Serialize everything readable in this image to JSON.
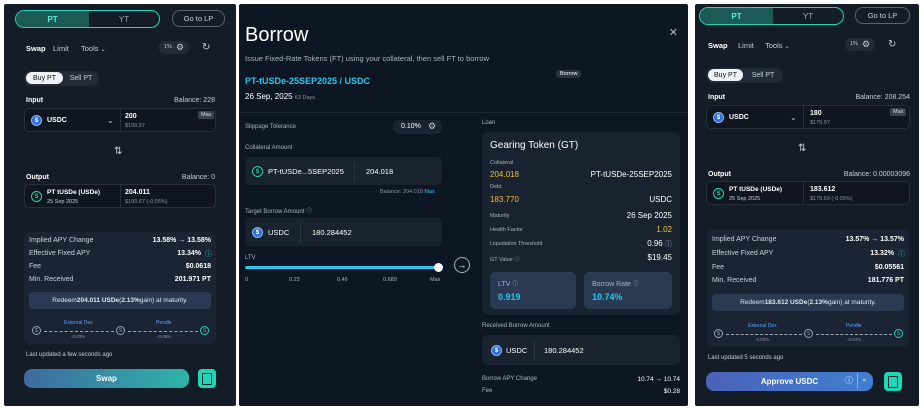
{
  "left": {
    "toggle": {
      "pt": "PT",
      "yt": "YT"
    },
    "go_lp": "Go to LP",
    "tabs": {
      "swap": "Swap",
      "limit": "Limit",
      "tools": "Tools"
    },
    "slippage": "1%",
    "seg": {
      "buy": "Buy PT",
      "sell": "Sell PT"
    },
    "input": {
      "label": "Input",
      "balance": "Balance: 228",
      "token": "USDC",
      "amount": "200",
      "usd": "$199.97",
      "max": "Max"
    },
    "output": {
      "label": "Output",
      "balance": "Balance: 0",
      "token": "PT tUSDe (USDe)",
      "date": "25 Sep 2025",
      "amount": "204.011",
      "usd": "$199.67 (-0.05%)"
    },
    "stats": [
      {
        "label": "Implied APY Change",
        "value": "13.58% → 13.58%"
      },
      {
        "label": "Effective Fixed APY",
        "value": "13.34%"
      },
      {
        "label": "Fee",
        "value": "$0.0618"
      },
      {
        "label": "Min. Received",
        "value": "201.971 PT"
      }
    ],
    "redeem": {
      "pre": "Redeem ",
      "amt": "204.011 USDe",
      "mid": " (",
      "gain": "2.13%",
      "post": " gain) at maturity."
    },
    "route": {
      "a": "External Dex",
      "a_pct": "-0.03%",
      "b": "Pendle",
      "b_pct": "-0.06%"
    },
    "updated": "Last updated a few seconds ago",
    "action": "Swap"
  },
  "middle": {
    "title": "Borrow",
    "subtitle": "Issue Fixed-Rate Tokens (FT) using your collateral, then sell FT to borrow",
    "pair": "PT-tUSDe-25SEP2025 / USDC",
    "tooltip": "Borrow",
    "date": "26 Sep, 2025",
    "days": "63 Days",
    "slippage_label": "Slippage Tolerance",
    "slippage_value": "0.10%",
    "collateral_label": "Collateral Amount",
    "collateral_token": "PT-tUSDe...5SEP2025",
    "collateral_amount": "204.018",
    "collateral_balance": "Balance: 204.018",
    "max": "Max",
    "target_label": "Target Borrow Amount",
    "target_token": "USDC",
    "target_amount": "180.284452",
    "ltv_label": "LTV",
    "ltv_ticks": [
      "0",
      "0.23",
      "0.46",
      "0.689",
      "Max"
    ],
    "ltv_fill": 1.0,
    "loan_label": "Loan",
    "gt_title": "Gearing Token (GT)",
    "gt_rows": [
      {
        "label": "Collateral",
        "value_left": "204.018",
        "value_right": "PT-tUSDe-25SEP2025"
      },
      {
        "label": "Debt",
        "value_left": "183.770",
        "value_right": "USDC"
      },
      {
        "label": "Maturity",
        "value": "26 Sep 2025"
      },
      {
        "label": "Health Factor",
        "value": "1.02"
      },
      {
        "label": "Liquidation Threshold",
        "value": "0.96"
      },
      {
        "label": "GT Value",
        "value": "$19.45"
      }
    ],
    "ltv_card": {
      "label": "LTV",
      "value": "0.919"
    },
    "rate_card": {
      "label": "Borrow Rate",
      "value": "10.74%"
    },
    "received_label": "Received Borrow Amount",
    "received_token": "USDC",
    "received_amount": "180.284452",
    "apy_label": "Borrow APY Change",
    "apy_value": "10.74 → 10.74",
    "fee_label": "Fee",
    "fee_value": "$0.28"
  },
  "right": {
    "toggle": {
      "pt": "PT",
      "yt": "YT"
    },
    "go_lp": "Go to LP",
    "tabs": {
      "swap": "Swap",
      "limit": "Limit",
      "tools": "Tools"
    },
    "slippage": "1%",
    "seg": {
      "buy": "Buy PT",
      "sell": "Sell PT"
    },
    "input": {
      "label": "Input",
      "balance": "Balance: 208.254",
      "token": "USDC",
      "amount": "180",
      "usd": "$179.97",
      "max": "Max"
    },
    "output": {
      "label": "Output",
      "balance": "Balance: 0.00003096",
      "token": "PT tUSDe (USDe)",
      "date": "25 Sep 2025",
      "amount": "183.612",
      "usd": "$179.69 (-0.05%)"
    },
    "stats": [
      {
        "label": "Implied APY Change",
        "value": "13.57% → 13.57%"
      },
      {
        "label": "Effective Fixed APY",
        "value": "13.32%"
      },
      {
        "label": "Fee",
        "value": "$0.05561"
      },
      {
        "label": "Min. Received",
        "value": "181.776 PT"
      }
    ],
    "redeem": {
      "pre": "Redeem ",
      "amt": "183.612 USDe",
      "mid": " (",
      "gain": "2.13%",
      "post": " gain) at maturity."
    },
    "route": {
      "a": "External Dex",
      "a_pct": "-0.03%",
      "b": "Pendle",
      "b_pct": "-0.04%"
    },
    "updated": "Last updated 5 seconds ago",
    "action": "Approve USDC"
  }
}
